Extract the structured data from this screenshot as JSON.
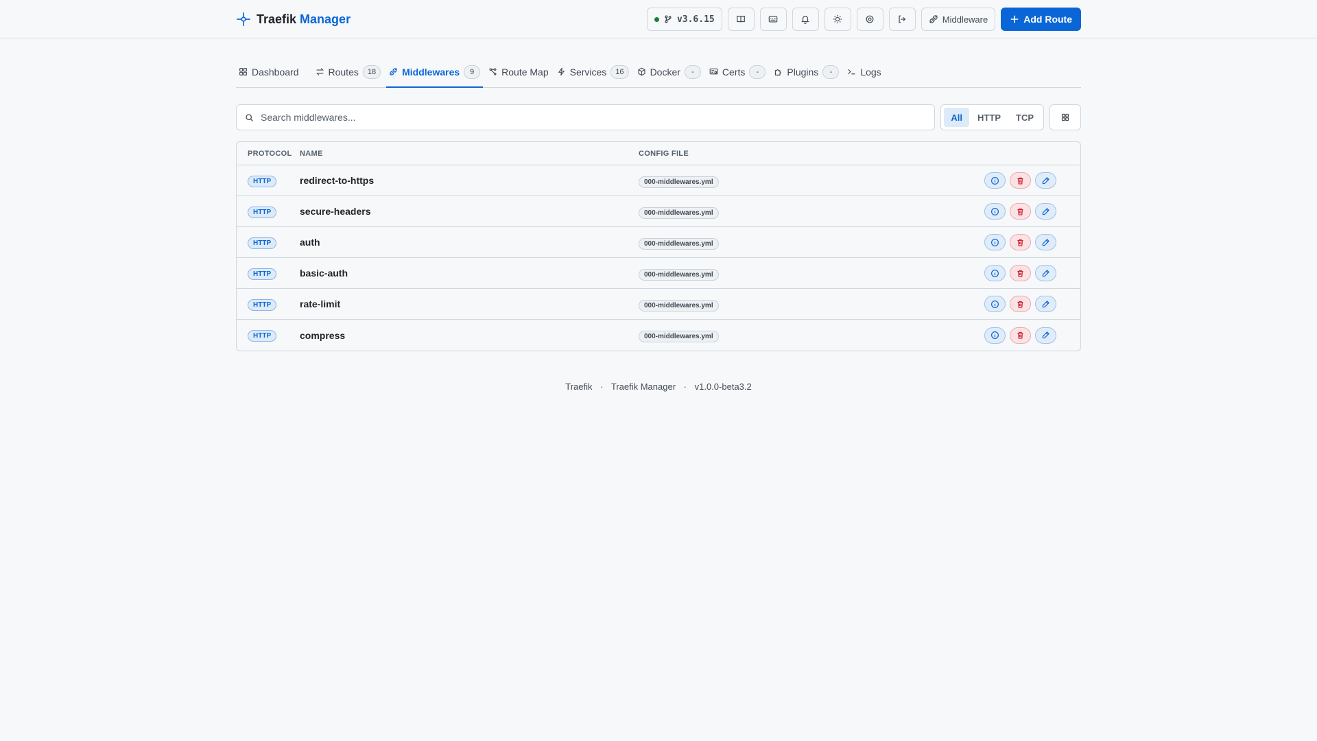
{
  "header": {
    "brand_primary": "Traefik",
    "brand_accent": "Manager",
    "version": "v3.6.15",
    "middleware_label": "Middleware",
    "add_route_label": "Add Route"
  },
  "tabs": [
    {
      "label": "Dashboard",
      "count": null,
      "icon": "grid-icon"
    },
    {
      "label": "Routes",
      "count": "18",
      "icon": "arrows-icon"
    },
    {
      "label": "Middlewares",
      "count": "9",
      "icon": "plug-icon",
      "active": true
    },
    {
      "label": "Route Map",
      "count": null,
      "icon": "map-icon"
    },
    {
      "label": "Services",
      "count": "16",
      "icon": "bolt-icon"
    },
    {
      "label": "Docker",
      "count": "-",
      "icon": "box-icon"
    },
    {
      "label": "Certs",
      "count": "-",
      "icon": "cert-icon"
    },
    {
      "label": "Plugins",
      "count": "-",
      "icon": "puzzle-icon"
    },
    {
      "label": "Logs",
      "count": null,
      "icon": "terminal-icon"
    }
  ],
  "search": {
    "placeholder": "Search middlewares..."
  },
  "filters": {
    "all": "All",
    "http": "HTTP",
    "tcp": "TCP",
    "selected": "All"
  },
  "table": {
    "columns": {
      "protocol": "PROTOCOL",
      "name": "NAME",
      "config_file": "CONFIG FILE"
    },
    "rows": [
      {
        "protocol": "HTTP",
        "name": "redirect-to-https",
        "file": "000-middlewares.yml"
      },
      {
        "protocol": "HTTP",
        "name": "secure-headers",
        "file": "000-middlewares.yml"
      },
      {
        "protocol": "HTTP",
        "name": "auth",
        "file": "000-middlewares.yml"
      },
      {
        "protocol": "HTTP",
        "name": "basic-auth",
        "file": "000-middlewares.yml"
      },
      {
        "protocol": "HTTP",
        "name": "rate-limit",
        "file": "000-middlewares.yml"
      },
      {
        "protocol": "HTTP",
        "name": "compress",
        "file": "000-middlewares.yml"
      }
    ]
  },
  "footer": {
    "a": "Traefik",
    "sep": "·",
    "b": "Traefik Manager",
    "c": "v1.0.0-beta3.2"
  },
  "colors": {
    "accent": "#0a66d6",
    "danger": "#cf222e",
    "status_ok": "#1a7f37"
  }
}
